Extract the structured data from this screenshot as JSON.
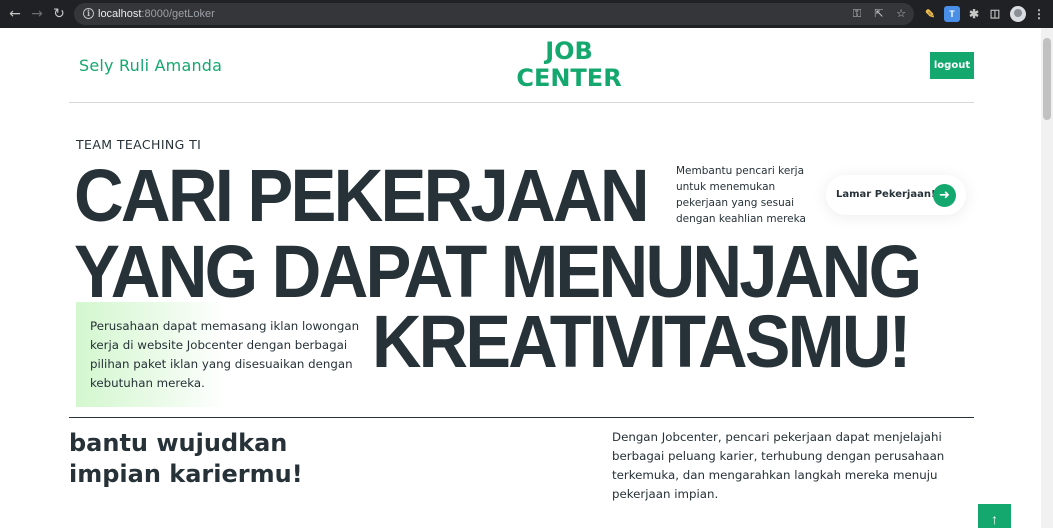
{
  "browser": {
    "url_host": "localhost",
    "url_path": ":8000/getLoker",
    "icons": [
      "back-icon",
      "forward-icon",
      "reload-icon",
      "info-icon",
      "key-icon",
      "share-icon",
      "star-icon",
      "pencil-extension-icon",
      "translate-extension-icon",
      "puzzle-icon",
      "sidebar-icon",
      "profile-avatar",
      "menu-icon"
    ]
  },
  "header": {
    "user_name": "Sely Ruli Amanda",
    "logo_line1": "JOB",
    "logo_line2": "CENTER",
    "logout_label": "logout"
  },
  "hero": {
    "eyebrow": "TEAM TEACHING TI",
    "headline_line1": "CARI PEKERJAAN",
    "headline_line2": "YANG DAPAT MENUNJANG",
    "headline_line3": "KREATIVITASMU!",
    "side_description": "Membantu pencari kerja untuk menemukan pekerjaan yang sesuai dengan keahlian mereka",
    "apply_label": "Lamar Pekerjaan!",
    "promo_text": "Perusahaan dapat memasang iklan lowongan kerja di website Jobcenter dengan berbagai pilihan paket iklan yang disesuaikan dengan kebutuhan mereka."
  },
  "section": {
    "title": "bantu wujudkan impian kariermu!",
    "description": "Dengan Jobcenter, pencari pekerjaan dapat menjelajahi berbagai peluang karier, terhubung dengan perusahaan terkemuka, dan mengarahkan langkah mereka menuju pekerjaan impian."
  },
  "colors": {
    "brand": "#14a86f",
    "text_dark": "#263238",
    "promo_bg": "#d3f7cf"
  }
}
